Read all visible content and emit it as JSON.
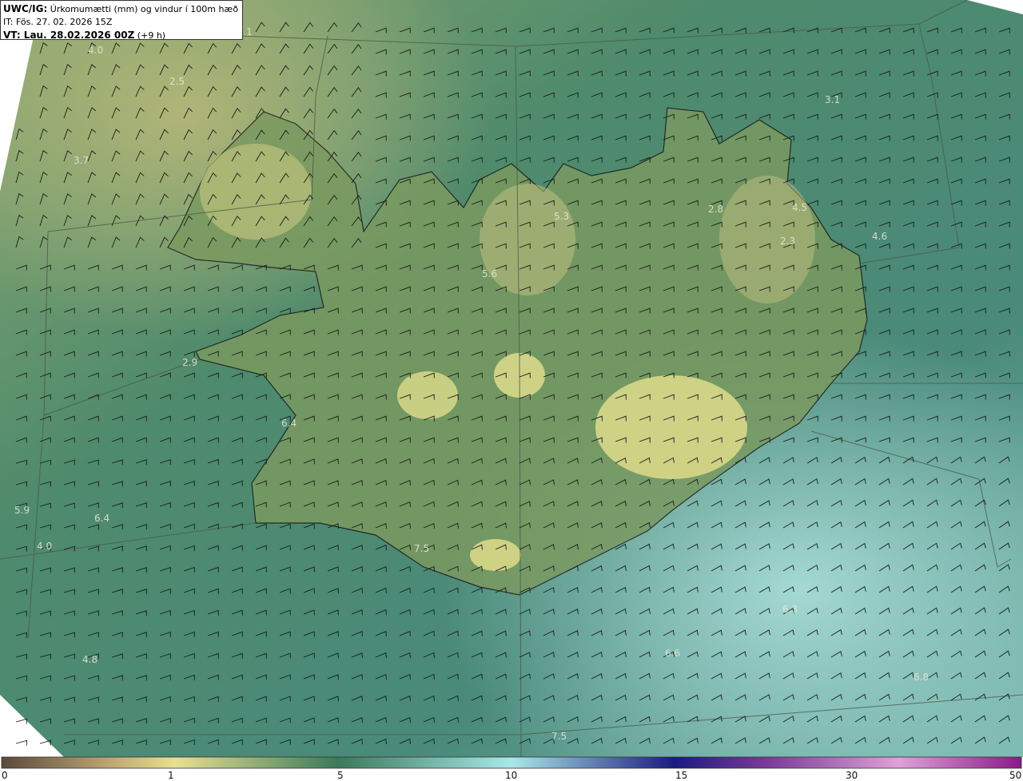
{
  "header": {
    "product": "UWC/IG:",
    "title": " Úrkomumætti (mm) og vindur í 100m hæð",
    "init_time": "IT: Fös. 27. 02. 2026 15Z",
    "valid_prefix": "VT: Lau. 28.02.2026 00Z",
    "valid_suffix": " (+9 h)"
  },
  "colorbar": {
    "ticks": [
      "0",
      "1",
      "5",
      "10",
      "15",
      "30",
      "50"
    ],
    "colors": [
      "#5a4a3a",
      "#b8a070",
      "#e8e090",
      "#5a9a70",
      "#3a7a70",
      "#a8e8e8",
      "#1a1a80",
      "#7a3a9a",
      "#e0a0d8",
      "#8a1a8a"
    ]
  },
  "value_labels": [
    {
      "text": "4.0"
    },
    {
      "text": "2.5"
    },
    {
      "text": "3.7"
    },
    {
      "text": "1"
    },
    {
      "text": "3.1"
    },
    {
      "text": "5.3"
    },
    {
      "text": "2.8"
    },
    {
      "text": "4.5"
    },
    {
      "text": "4.6"
    },
    {
      "text": "2.3"
    },
    {
      "text": "5.6"
    },
    {
      "text": "2.9"
    },
    {
      "text": "6.4"
    },
    {
      "text": "5.9"
    },
    {
      "text": "6.4"
    },
    {
      "text": "4.0"
    },
    {
      "text": "7.5"
    },
    {
      "text": "6.3"
    },
    {
      "text": "6.6"
    },
    {
      "text": "6.8"
    },
    {
      "text": "4.8"
    },
    {
      "text": "7.5"
    }
  ]
}
